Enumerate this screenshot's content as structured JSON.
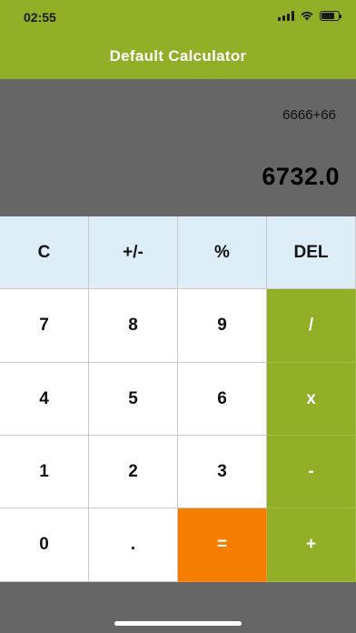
{
  "status_bar": {
    "time": "02:55",
    "wifi_icon": "wifi-icon",
    "battery_icon": "battery-charging-icon"
  },
  "header": {
    "title": "Default Calculator"
  },
  "display": {
    "expression": "6666+66",
    "result": "6732.0"
  },
  "keys": [
    {
      "label": "C",
      "kind": "func",
      "name": "clear-button"
    },
    {
      "label": "+/-",
      "kind": "func",
      "name": "sign-toggle-button"
    },
    {
      "label": "%",
      "kind": "func",
      "name": "percent-button"
    },
    {
      "label": "DEL",
      "kind": "func",
      "name": "delete-button"
    },
    {
      "label": "7",
      "kind": "digit",
      "name": "digit-7-button"
    },
    {
      "label": "8",
      "kind": "digit",
      "name": "digit-8-button"
    },
    {
      "label": "9",
      "kind": "digit",
      "name": "digit-9-button"
    },
    {
      "label": "/",
      "kind": "op",
      "name": "divide-button"
    },
    {
      "label": "4",
      "kind": "digit",
      "name": "digit-4-button"
    },
    {
      "label": "5",
      "kind": "digit",
      "name": "digit-5-button"
    },
    {
      "label": "6",
      "kind": "digit",
      "name": "digit-6-button"
    },
    {
      "label": "x",
      "kind": "op",
      "name": "multiply-button"
    },
    {
      "label": "1",
      "kind": "digit",
      "name": "digit-1-button"
    },
    {
      "label": "2",
      "kind": "digit",
      "name": "digit-2-button"
    },
    {
      "label": "3",
      "kind": "digit",
      "name": "digit-3-button"
    },
    {
      "label": "-",
      "kind": "op",
      "name": "subtract-button"
    },
    {
      "label": "0",
      "kind": "digit",
      "name": "digit-0-button"
    },
    {
      "label": ".",
      "kind": "digit",
      "name": "decimal-button"
    },
    {
      "label": "=",
      "kind": "eq",
      "name": "equals-button"
    },
    {
      "label": "+",
      "kind": "op",
      "name": "add-button"
    }
  ],
  "colors": {
    "header_bg": "#92AD26",
    "display_bg": "#666666",
    "function_key_bg": "#DDEEF9",
    "operator_key_bg": "#92AD26",
    "equals_key_bg": "#F57D00",
    "digit_key_bg": "#FFFFFF"
  }
}
